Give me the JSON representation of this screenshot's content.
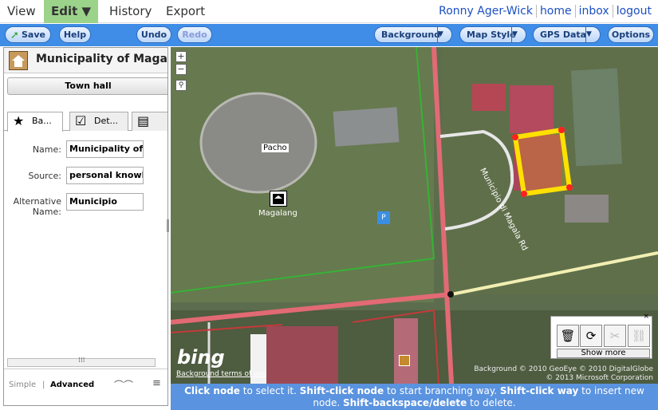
{
  "topnav": {
    "menus": [
      {
        "label": "View"
      },
      {
        "label": "Edit ▼"
      },
      {
        "label": "History"
      },
      {
        "label": "Export"
      }
    ],
    "user_links": [
      "Ronny Ager-Wick",
      "home",
      "inbox",
      "logout"
    ]
  },
  "toolbar": {
    "save": "Save",
    "help": "Help",
    "undo": "Undo",
    "redo": "Redo",
    "background": "Background",
    "map_style": "Map Style",
    "gps_data": "GPS Data",
    "options": "Options"
  },
  "panel": {
    "title": "Municipality of Magalan",
    "preset": "Town hall",
    "tabs": [
      "Ba...",
      "Det...",
      ""
    ],
    "fields": {
      "name_label": "Name:",
      "name_value": "Municipality of M",
      "source_label": "Source:",
      "source_value": "personal knowle",
      "alt_label_1": "Alternative",
      "alt_label_2": "Name:",
      "alt_value": "Municipio"
    },
    "modes": {
      "simple": "Simple",
      "separator": "|",
      "advanced": "Advanced"
    }
  },
  "map": {
    "labels": {
      "pacho": "Pacho",
      "magalang": "Magalang",
      "street": "Municipio di Magala Rd"
    },
    "bing": "bing",
    "terms": "Background terms of use",
    "copyright_1": "Background © 2010 GeoEye © 2010 DigitalGlobe",
    "copyright_2": "© 2013 Microsoft Corporation",
    "show_more": "Show more"
  },
  "help": {
    "p1": "Click node",
    "t1": " to select it. ",
    "p2": "Shift-click node",
    "t2": " to start branching way. ",
    "p3": "Shift-click way",
    "t3": " to insert new node. ",
    "p4": "Shift-backspace/delete",
    "t4": " to delete."
  },
  "colors": {
    "nav_active": "#9bd38a",
    "toolbar": "#3f8de6",
    "help_bar": "#5a93df",
    "selection": "#ffe000"
  }
}
